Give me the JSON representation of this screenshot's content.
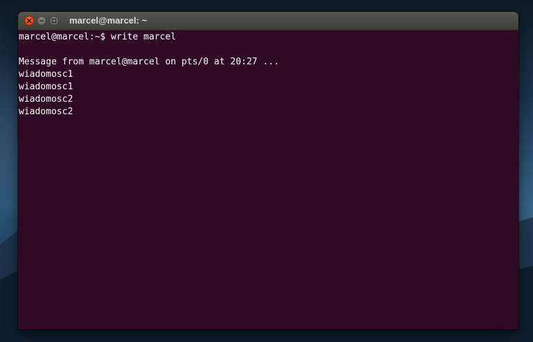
{
  "window": {
    "title": "marcel@marcel: ~",
    "controls": [
      {
        "name": "close",
        "icon": "close-icon"
      },
      {
        "name": "minimize",
        "icon": "minimize-icon"
      },
      {
        "name": "maximize",
        "icon": "maximize-icon"
      }
    ]
  },
  "terminal": {
    "lines": [
      "marcel@marcel:~$ write marcel",
      "",
      "Message from marcel@marcel on pts/0 at 20:27 ...",
      "wiadomosc1",
      "wiadomosc1",
      "wiadomosc2",
      "wiadomosc2"
    ],
    "background_color": "#300a24",
    "text_color": "#ffffff"
  }
}
